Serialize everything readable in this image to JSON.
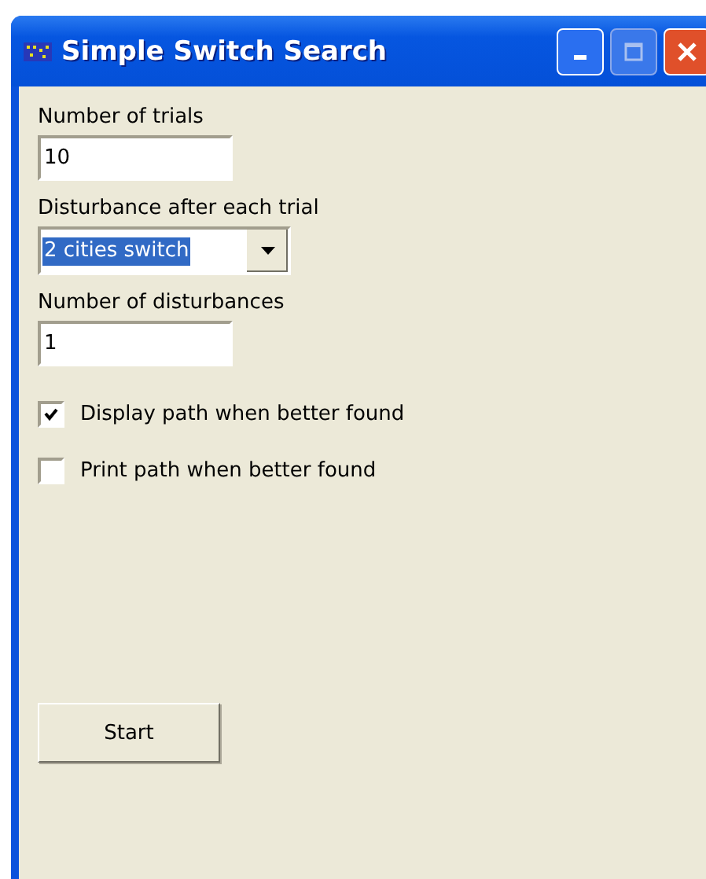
{
  "window": {
    "title": "Simple Switch Search"
  },
  "fields": [
    {
      "label": "Number of trials",
      "value": "10"
    }
  ],
  "dropdown": {
    "label": "Disturbance after each trial",
    "value": "2 cities switch"
  },
  "fields2": [
    {
      "label": "Number of disturbances",
      "value": "1"
    }
  ],
  "checkboxes": [
    {
      "label": "Display path when better found",
      "checked": true
    },
    {
      "label": "Print path when better found",
      "checked": false
    }
  ],
  "buttons": [
    "Start"
  ]
}
